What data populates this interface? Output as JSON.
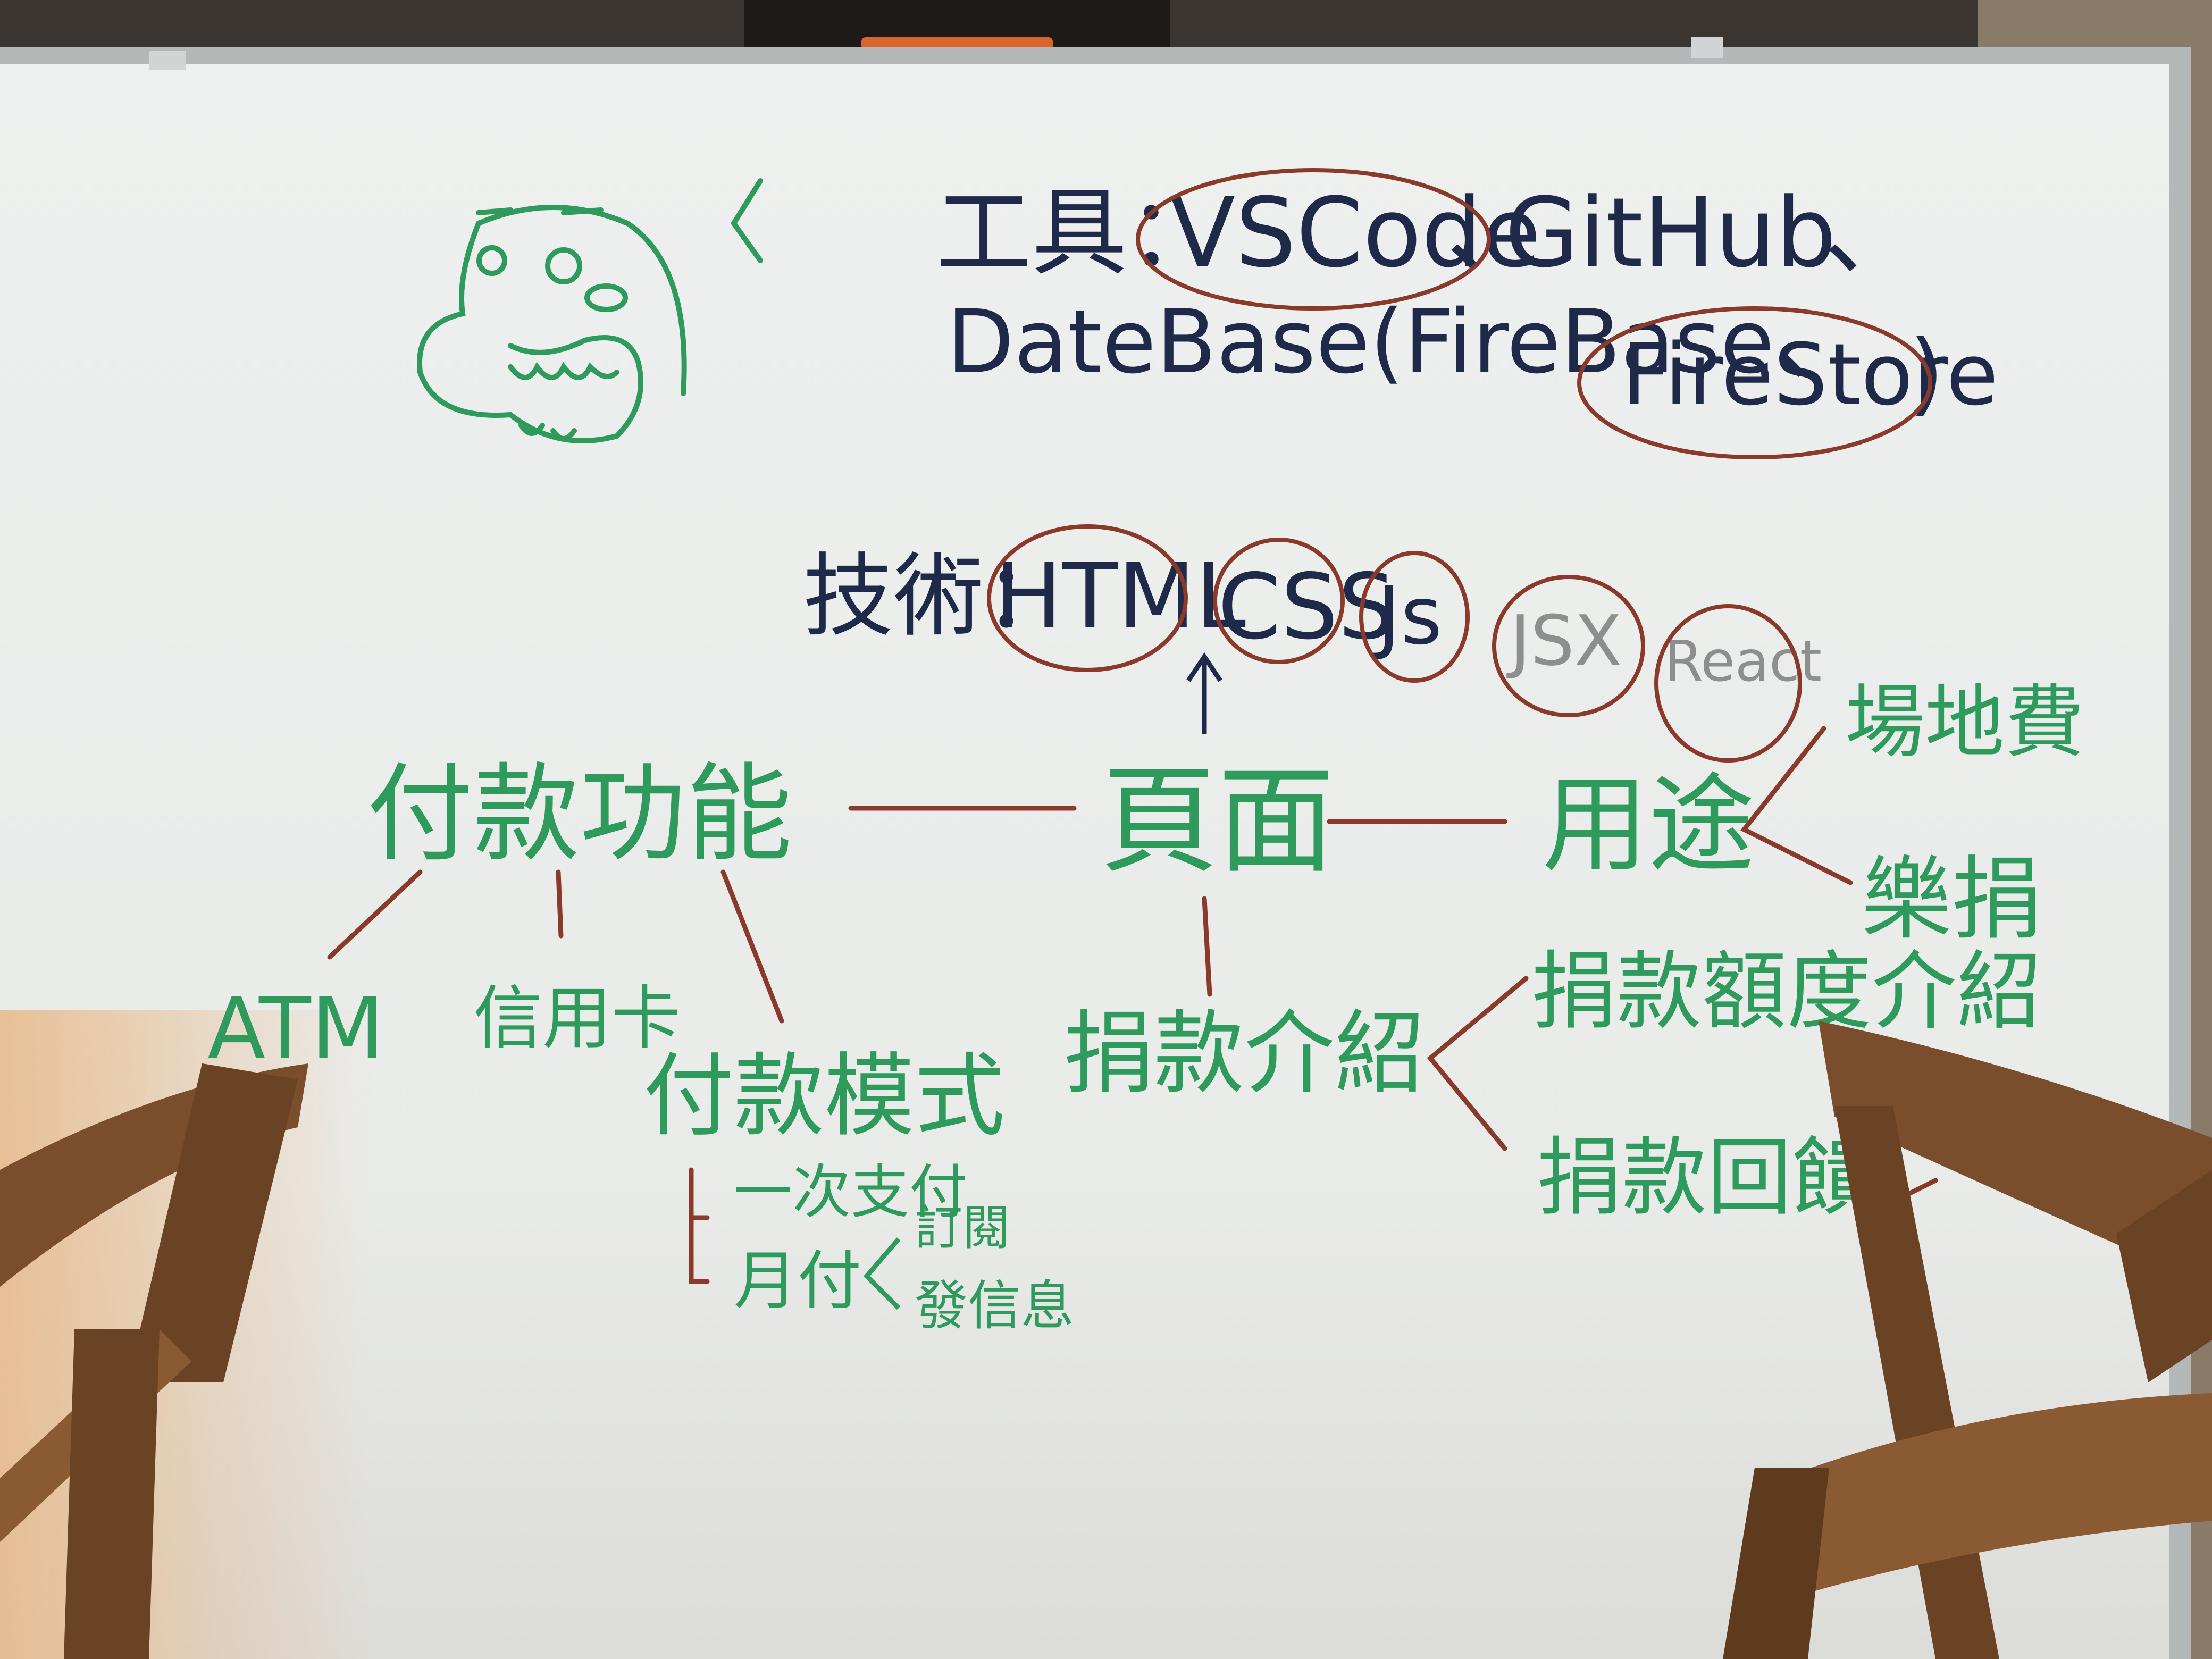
{
  "colors": {
    "ink_blue": "#1f2a4a",
    "ink_green": "#2e9a5c",
    "ink_red": "#8a3a2a",
    "board": "#eef0ef",
    "frame": "#b8bcbc",
    "chair": "#7a4e2c"
  },
  "tools": {
    "label": "工具：",
    "vscode": "VSCode",
    "sep1": "、",
    "github": "GitHub",
    "sep2": "、",
    "db_line": "DateBase(FireBase、",
    "firestore": "FireStore",
    "close": ")"
  },
  "tech": {
    "label": "技術：",
    "html": "HTML",
    "css": "CSS",
    "js": "Js",
    "jsx": "JSX",
    "react": "React"
  },
  "center": {
    "page": "頁面"
  },
  "payment": {
    "title": "付款功能",
    "atm": "ATM",
    "credit_card": "信用卡",
    "mode": "付款模式",
    "one_time": "一次支付",
    "monthly": "月付",
    "subscribe": "訂閱",
    "send_message": "發信息"
  },
  "usage": {
    "title": "用途",
    "venue_fee": "場地費",
    "donation": "樂捐"
  },
  "donation_intro": {
    "title": "捐款介紹",
    "amount_intro": "捐款額度介紹",
    "feedback": "捐款回饋"
  },
  "mascot": "dinosaur-doodle"
}
